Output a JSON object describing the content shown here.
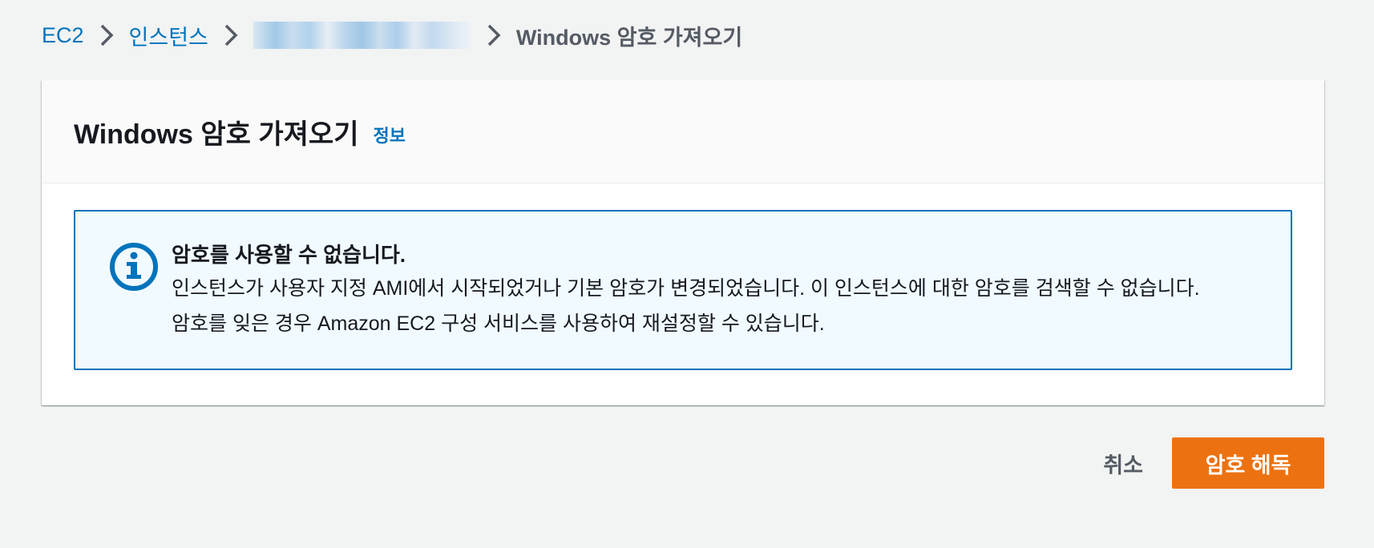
{
  "breadcrumb": {
    "ec2": "EC2",
    "instances": "인스턴스",
    "current": "Windows 암호 가져오기"
  },
  "panel": {
    "title": "Windows 암호 가져오기",
    "info_link": "정보"
  },
  "alert": {
    "icon": "info-circle-icon",
    "title": "암호를 사용할 수 없습니다.",
    "line1": "인스턴스가 사용자 지정 AMI에서 시작되었거나 기본 암호가 변경되었습니다. 이 인스턴스에 대한 암호를 검색할 수 없습니다.",
    "line2": "암호를 잊은 경우 Amazon EC2 구성 서비스를 사용하여 재설정할 수 있습니다."
  },
  "actions": {
    "cancel": "취소",
    "decrypt": "암호 해독"
  },
  "colors": {
    "link": "#0073bb",
    "primary_button": "#ec7211",
    "alert_bg": "#f1faff",
    "alert_border": "#0073bb"
  }
}
